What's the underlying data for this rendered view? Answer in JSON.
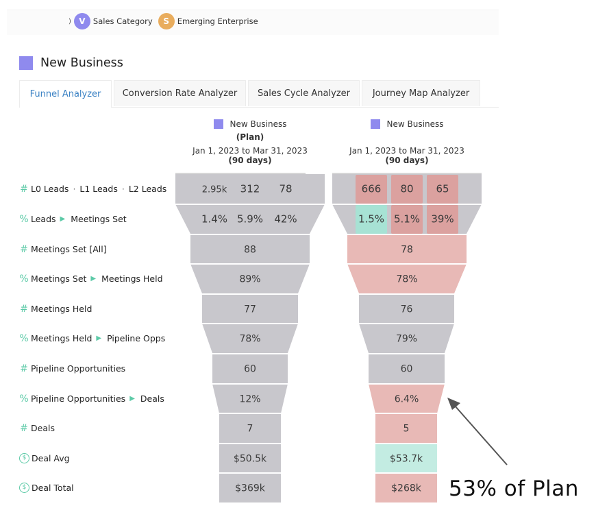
{
  "filter_chips": {
    "cut_glyph": ")",
    "items": [
      {
        "letter": "V",
        "label": "Sales Category",
        "color": "#8f8aee"
      },
      {
        "letter": "S",
        "label": "Emerging Enterprise",
        "color": "#e9ad5e"
      }
    ]
  },
  "section": {
    "title": "New Business",
    "color": "#8f8aee"
  },
  "tabs": [
    {
      "label": "Funnel Analyzer",
      "active": true
    },
    {
      "label": "Conversion Rate Analyzer",
      "active": false
    },
    {
      "label": "Sales Cycle Analyzer",
      "active": false
    },
    {
      "label": "Journey Map Analyzer",
      "active": false
    }
  ],
  "columns": [
    {
      "legend": "New Business",
      "subtitle": "(Plan)",
      "date_range": "Jan 1, 2023 to Mar 31, 2023",
      "days": "(90 days)"
    },
    {
      "legend": "New Business",
      "subtitle": "",
      "date_range": "Jan 1, 2023 to Mar 31, 2023",
      "days": "(90 days)"
    }
  ],
  "colors": {
    "neutral": "#c8c7cc",
    "below_plan_strong": "#dba19f",
    "below_plan": "#e8b9b6",
    "above_plan": "#a7e2d4",
    "above_plan_light": "#c3ece2",
    "accent_icon": "#5ccaa7",
    "legend": "#8f8aee"
  },
  "rows": [
    {
      "icon": "hash",
      "label": [
        "L0 Leads",
        "L1 Leads",
        "L2 Leads"
      ],
      "sep": "dot",
      "kind": "count",
      "plan": [
        "2.95k",
        "312",
        "78"
      ],
      "actual": [
        "666",
        "80",
        "65"
      ],
      "actual_status": [
        "below_strong",
        "below_strong",
        "below_strong"
      ]
    },
    {
      "icon": "percent",
      "label": [
        "Leads",
        "Meetings Set"
      ],
      "sep": "arrow",
      "kind": "rate",
      "plan": [
        "1.4%",
        "5.9%",
        "42%"
      ],
      "actual": [
        "1.5%",
        "5.1%",
        "39%"
      ],
      "actual_status": [
        "above",
        "below_strong",
        "below_strong"
      ]
    },
    {
      "icon": "hash",
      "label": [
        "Meetings Set [All]"
      ],
      "kind": "count",
      "plan": [
        "88"
      ],
      "actual": [
        "78"
      ],
      "actual_status": [
        "below"
      ]
    },
    {
      "icon": "percent",
      "label": [
        "Meetings Set",
        "Meetings Held"
      ],
      "sep": "arrow",
      "kind": "rate",
      "plan": [
        "89%"
      ],
      "actual": [
        "78%"
      ],
      "actual_status": [
        "below"
      ]
    },
    {
      "icon": "hash",
      "label": [
        "Meetings Held"
      ],
      "kind": "count",
      "plan": [
        "77"
      ],
      "actual": [
        "76"
      ],
      "actual_status": [
        "neutral"
      ]
    },
    {
      "icon": "percent",
      "label": [
        "Meetings Held",
        "Pipeline Opps"
      ],
      "sep": "arrow",
      "kind": "rate",
      "plan": [
        "78%"
      ],
      "actual": [
        "79%"
      ],
      "actual_status": [
        "neutral"
      ]
    },
    {
      "icon": "hash",
      "label": [
        "Pipeline Opportunities"
      ],
      "kind": "count",
      "plan": [
        "60"
      ],
      "actual": [
        "60"
      ],
      "actual_status": [
        "neutral"
      ]
    },
    {
      "icon": "percent",
      "label": [
        "Pipeline Opportunities",
        "Deals"
      ],
      "sep": "arrow",
      "kind": "rate",
      "plan": [
        "12%"
      ],
      "actual": [
        "6.4%"
      ],
      "actual_status": [
        "below"
      ]
    },
    {
      "icon": "hash",
      "label": [
        "Deals"
      ],
      "kind": "count",
      "plan": [
        "7"
      ],
      "actual": [
        "5"
      ],
      "actual_status": [
        "below"
      ]
    },
    {
      "icon": "dollar",
      "label": [
        "Deal Avg"
      ],
      "kind": "count",
      "plan": [
        "$50.5k"
      ],
      "actual": [
        "$53.7k"
      ],
      "actual_status": [
        "above_light"
      ]
    },
    {
      "icon": "dollar",
      "label": [
        "Deal Total"
      ],
      "kind": "count",
      "plan": [
        "$369k"
      ],
      "actual": [
        "$268k"
      ],
      "actual_status": [
        "below"
      ]
    }
  ],
  "annotation": {
    "text": "53% of Plan"
  }
}
